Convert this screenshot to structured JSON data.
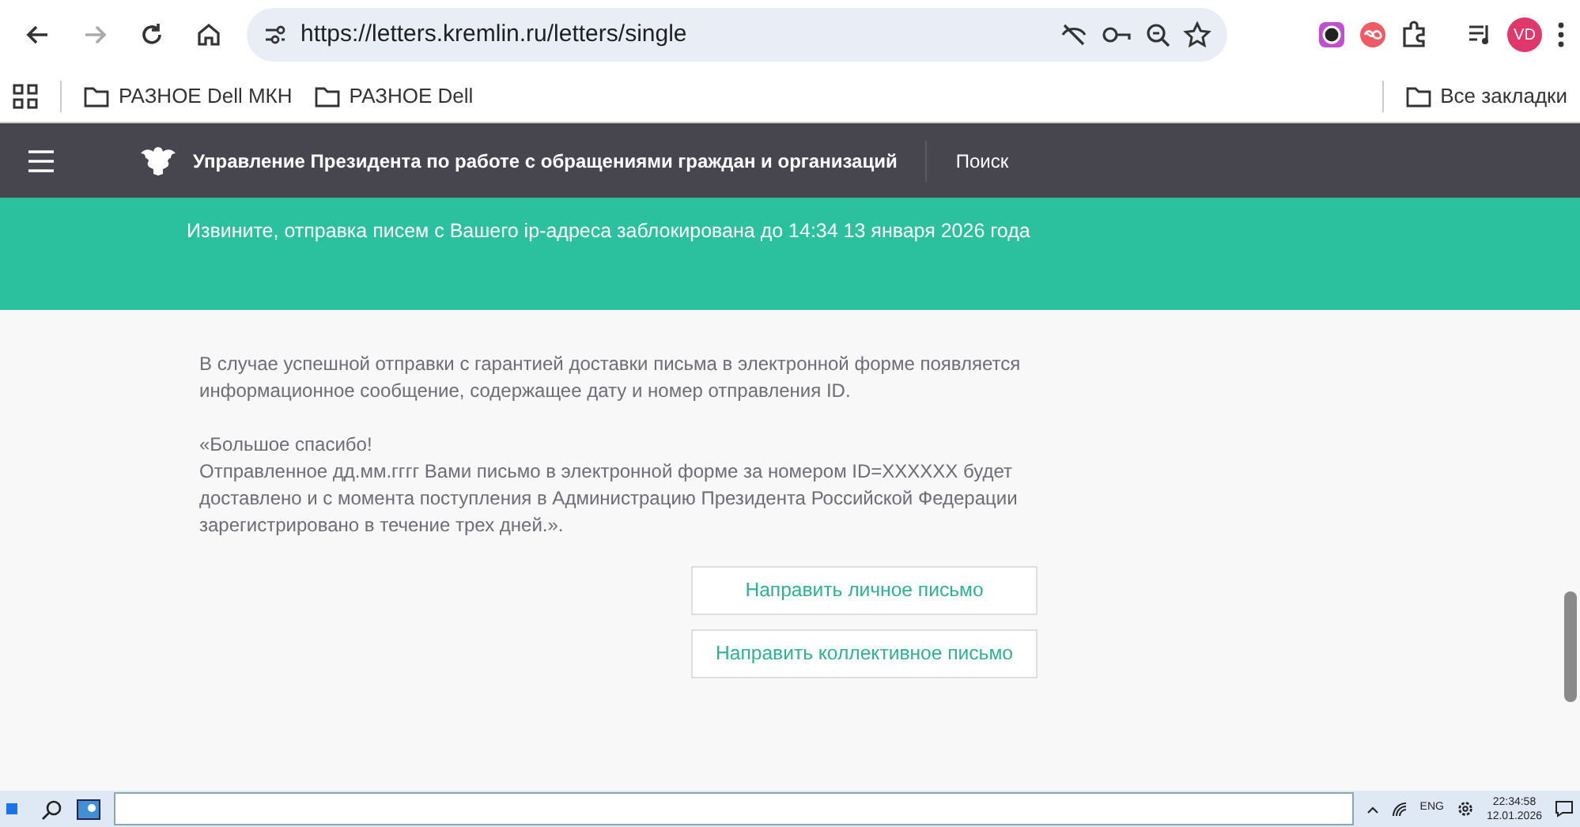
{
  "browser": {
    "url": "https://letters.kremlin.ru/letters/single",
    "profile_initials": "VD"
  },
  "bookmarks": {
    "items": [
      "РАЗНОЕ Dell МКН",
      "РАЗНОЕ Dell"
    ],
    "all_label": "Все закладки"
  },
  "site_header": {
    "title": "Управление Президента по работе с обращениями граждан и организаций",
    "search_link": "Поиск"
  },
  "alert": {
    "text": "Извините, отправка писем с Вашего ip-адреса заблокирована до 14:34 13 января 2026 года"
  },
  "paragraphs": [
    [
      "В случае успешной отправки с гарантией доставки письма в электронной форме появляется информационное сообщение, содержащее дату и номер отправления ID."
    ],
    [
      "«Большое спасибо!",
      "Отправленное дд.мм.гггг Вами письмо в электронной форме за номером ID=XXXXXX будет доставлено и с момента поступления в Администрацию Президента Российской Федерации зарегистрировано в течение трех дней.»."
    ]
  ],
  "buttons": [
    "Направить личное письмо",
    "Направить коллективное письмо"
  ],
  "taskbar": {
    "language": "ENG",
    "time": "22:34:58",
    "date": "12.01.2026"
  }
}
